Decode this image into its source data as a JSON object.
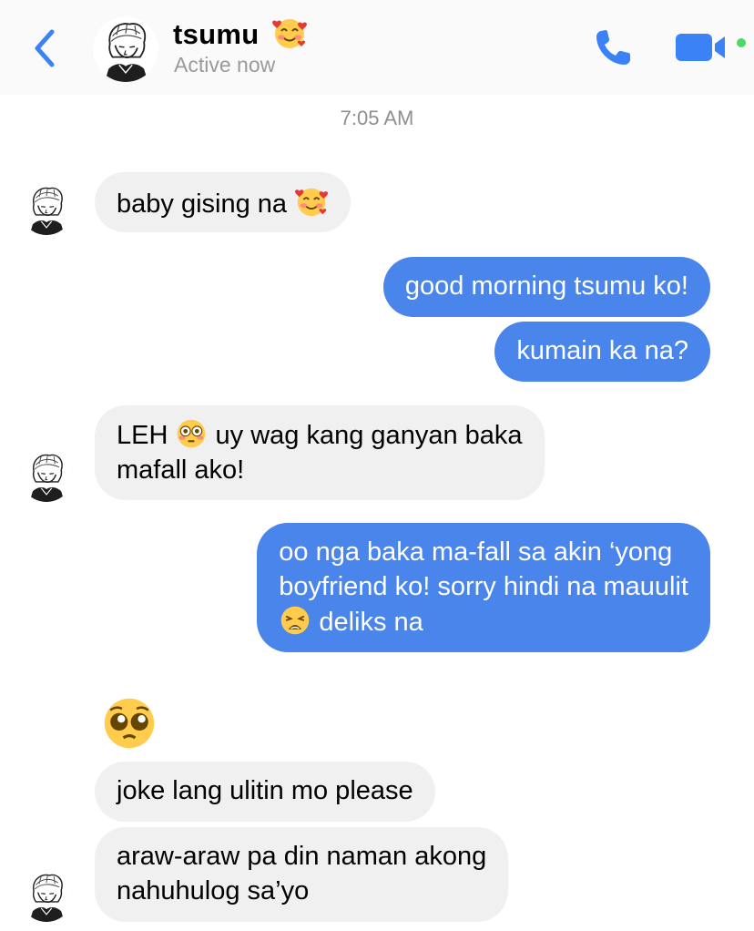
{
  "header": {
    "contact_name": "tsumu",
    "status": "Active now",
    "name_emoji": "smiling-face-with-hearts",
    "icons": [
      "back-chevron-icon",
      "phone-icon",
      "video-camera-icon"
    ],
    "accent_color": "#3b82f6",
    "online_dot_color": "#4cd964"
  },
  "thread": {
    "timestamp": "7:05 AM",
    "messages": [
      {
        "from": "contact",
        "text": "baby gising na",
        "emoji": "smiling-face-with-hearts"
      },
      {
        "from": "me",
        "text": "good morning tsumu ko!"
      },
      {
        "from": "me",
        "text": "kumain ka na?"
      },
      {
        "from": "contact",
        "line1_a": "LEH",
        "line1_emoji": "flushed-face",
        "line1_b": "uy wag kang ganyan baka",
        "line2": "mafall ako!"
      },
      {
        "from": "me",
        "line1": "oo nga baka ma-fall sa akin ‘yong",
        "line2": "boyfriend ko! sorry hindi na mauulit",
        "line3_emoji": "weary-face",
        "line3": "deliks na"
      },
      {
        "from": "contact",
        "emoji_only": "pleading-face"
      },
      {
        "from": "contact",
        "text": "joke lang ulitin mo please"
      },
      {
        "from": "contact",
        "line1": "araw-araw pa din naman akong",
        "line2": "nahuhulog sa’yo"
      }
    ]
  },
  "colors": {
    "incoming_bubble": "#f0f0f0",
    "outgoing_bubble": "#4a85eb",
    "timestamp_text": "#8e8e93"
  }
}
